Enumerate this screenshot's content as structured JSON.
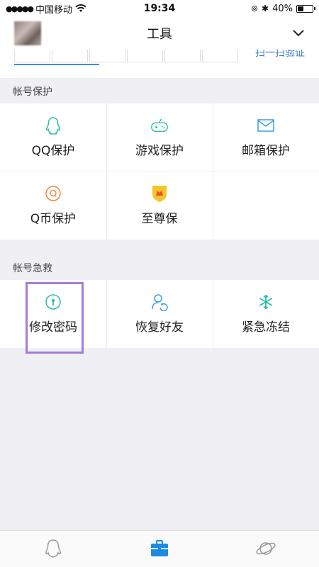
{
  "status_bar": {
    "carrier": "中国移动",
    "time": "19:34",
    "battery": "40%",
    "battery_level": 0.4
  },
  "header": {
    "title": "工具"
  },
  "verify": {
    "scan_link": "扫一扫验证"
  },
  "sections": {
    "protect": {
      "label": "帐号保护",
      "items": [
        {
          "label": "QQ保护",
          "icon": "penguin-icon"
        },
        {
          "label": "游戏保护",
          "icon": "gamepad-icon"
        },
        {
          "label": "邮箱保护",
          "icon": "mail-icon"
        },
        {
          "label": "Q币保护",
          "icon": "q-coin-icon"
        },
        {
          "label": "至尊保",
          "icon": "shield-icon"
        }
      ]
    },
    "rescue": {
      "label": "帐号急救",
      "items": [
        {
          "label": "修改密码",
          "icon": "key-icon"
        },
        {
          "label": "恢复好友",
          "icon": "friend-restore-icon"
        },
        {
          "label": "紧急冻结",
          "icon": "snowflake-icon"
        }
      ]
    }
  },
  "tabbar": {
    "tabs": [
      "qq-tab-icon",
      "toolbox-tab-icon",
      "planet-tab-icon"
    ],
    "active": "toolbox-tab-icon"
  },
  "colors": {
    "accent": "#3a8ee6",
    "teal": "#2bbfa8",
    "highlight": "#a57cd8"
  }
}
